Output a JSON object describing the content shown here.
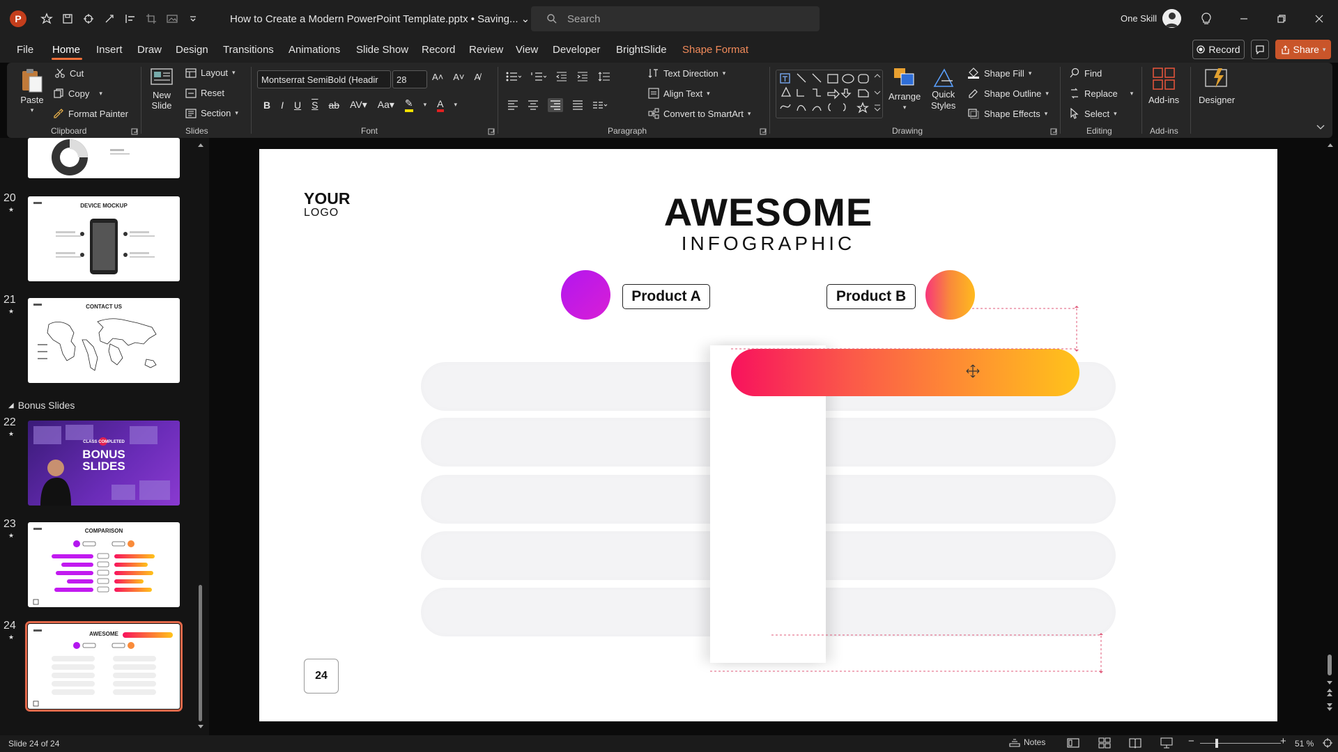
{
  "app": {
    "logo_letter": "P"
  },
  "titlebar": {
    "doc_title": "How to Create a Modern PowerPoint Template.pptx • Saving... ⌄",
    "search_placeholder": "Search",
    "account_name": "One Skill"
  },
  "tabs": [
    "File",
    "Home",
    "Insert",
    "Draw",
    "Design",
    "Transitions",
    "Animations",
    "Slide Show",
    "Record",
    "Review",
    "View",
    "Developer",
    "BrightSlide",
    "Shape Format"
  ],
  "tab_active": "Home",
  "header_buttons": {
    "record": "Record",
    "share": "Share"
  },
  "ribbon": {
    "clipboard": {
      "paste": "Paste",
      "cut": "Cut",
      "copy": "Copy",
      "format_painter": "Format Painter",
      "group": "Clipboard"
    },
    "slides": {
      "new_slide": "New",
      "new_slide2": "Slide",
      "layout": "Layout",
      "reset": "Reset",
      "section": "Section",
      "group": "Slides"
    },
    "font": {
      "family": "Montserrat SemiBold (Headir",
      "size": "28",
      "group": "Font"
    },
    "paragraph": {
      "text_direction": "Text Direction",
      "align_text": "Align Text",
      "convert_smartart": "Convert to SmartArt",
      "group": "Paragraph"
    },
    "drawing": {
      "arrange": "Arrange",
      "quick_styles": "Quick",
      "quick_styles2": "Styles",
      "shape_fill": "Shape Fill",
      "shape_outline": "Shape Outline",
      "shape_effects": "Shape Effects",
      "group": "Drawing"
    },
    "editing": {
      "find": "Find",
      "replace": "Replace",
      "select": "Select",
      "group": "Editing"
    },
    "addins": {
      "addins": "Add-ins",
      "group": "Add-ins"
    },
    "designer": {
      "label": "Designer"
    }
  },
  "thumbnails": {
    "section_name": "Bonus Slides",
    "items": [
      {
        "num": "",
        "title": ""
      },
      {
        "num": "20",
        "title": "DEVICE MOCKUP"
      },
      {
        "num": "21",
        "title": "CONTACT US"
      },
      {
        "num": "22",
        "title": "BONUS SLIDES",
        "subtitle": "CLASS COMPLETED"
      },
      {
        "num": "23",
        "title": "COMPARISON"
      },
      {
        "num": "24",
        "title": "AWESOME"
      }
    ]
  },
  "slide": {
    "logo_line1": "YOUR",
    "logo_line2": "LOGO",
    "title": "AWESOME",
    "subtitle": "INFOGRAPHIC",
    "product_a": "Product A",
    "product_b": "Product B",
    "page_number": "24",
    "colors": {
      "product_a": "#c21af0",
      "product_b_start": "#f7367a",
      "product_b_end": "#ffba1e",
      "bar_start": "#f8125d",
      "bar_end": "#ffc31a"
    }
  },
  "statusbar": {
    "slide_info": "Slide 24 of 24",
    "notes": "Notes",
    "zoom": "51 %"
  }
}
